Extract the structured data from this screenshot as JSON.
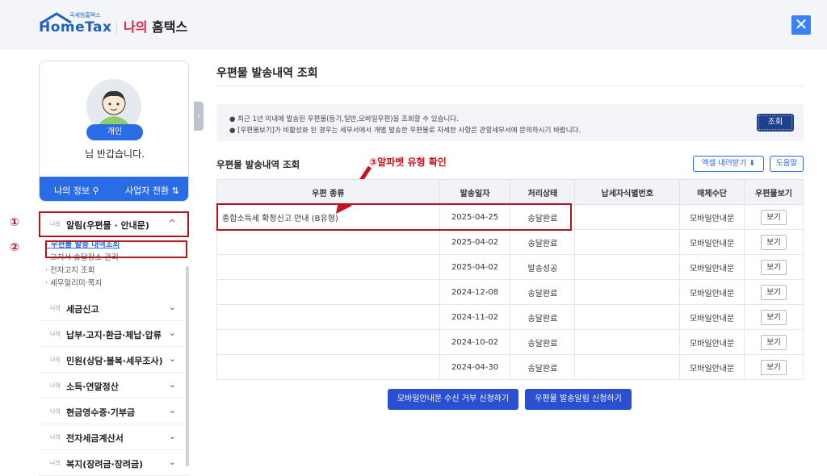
{
  "header": {
    "logo_small": "국세청홈택스",
    "logo_main": "HomeTax",
    "my_prefix": "나의",
    "my_suffix": "홈택스"
  },
  "profile": {
    "badge": "개인",
    "greeting": "님 반갑습니다.",
    "my_info": "나의 정보",
    "switch": "사업자 전환"
  },
  "menu": {
    "prefix": "나의",
    "sections": [
      {
        "label": "알림(우편물 · 안내문)",
        "chev": "^"
      },
      {
        "label": "세금신고",
        "chev": "⌄"
      },
      {
        "label": "납부·고지·환급·체납·압류",
        "chev": "⌄"
      },
      {
        "label": "민원(상담·불복·세무조사)",
        "chev": "⌄"
      },
      {
        "label": "소득·연말정산",
        "chev": "⌄"
      },
      {
        "label": "현금영수증·기부금",
        "chev": "⌄"
      },
      {
        "label": "전자세금계산서",
        "chev": "⌄"
      },
      {
        "label": "복지(장려금·장려금)",
        "chev": "⌄"
      }
    ],
    "sub_items": [
      "우편물 발송 내역조회",
      "고지서 송달장소 관리",
      "전자고지 조회",
      "세무알리미·쪽지"
    ]
  },
  "annotations": {
    "c1": "①",
    "c2": "②",
    "c3": "③알파벳 유형 확인"
  },
  "main": {
    "title": "우편물 발송내역 조회",
    "notice1": "최근 1년 이내에 발송된 우편물(등기,일반,모바일우편)을 조회할 수 있습니다.",
    "notice2": "[우편물보기]가 비활성화 된 경우는 세무서에서 개별 발송한 우편물로 자세한 사항은 관할세무서에 문의하시기 바랍니다.",
    "query_btn": "조회",
    "section_title": "우편물 발송내역 조회",
    "excel_btn": "엑셀 내려받기",
    "help_btn": "도움말",
    "table": {
      "headers": [
        "우편 종류",
        "발송일자",
        "처리상태",
        "납세자식별번호",
        "매체수단",
        "우편물보기"
      ],
      "rows": [
        {
          "type": "종합소득세 확정신고 안내 (B유형)",
          "date": "2025-04-25",
          "status": "송달완료",
          "id": "",
          "media": "모바일안내문",
          "view": "보기"
        },
        {
          "type": "",
          "date": "2025-04-02",
          "status": "송달완료",
          "id": "",
          "media": "모바일안내문",
          "view": "보기"
        },
        {
          "type": "",
          "date": "2025-04-02",
          "status": "발송성공",
          "id": "",
          "media": "모바일안내문",
          "view": "보기"
        },
        {
          "type": "",
          "date": "2024-12-08",
          "status": "송달완료",
          "id": "",
          "media": "모바일안내문",
          "view": "보기"
        },
        {
          "type": "",
          "date": "2024-11-02",
          "status": "송달완료",
          "id": "",
          "media": "모바일안내문",
          "view": "보기"
        },
        {
          "type": "",
          "date": "2024-10-02",
          "status": "송달완료",
          "id": "",
          "media": "모바일안내문",
          "view": "보기"
        },
        {
          "type": "",
          "date": "2024-04-30",
          "status": "송달완료",
          "id": "",
          "media": "모바일안내문",
          "view": "보기"
        }
      ]
    },
    "btn_reject": "모바일안내문 수신 거부 신청하기",
    "btn_notify": "우편물 발송알림 신청하기"
  },
  "colors": {
    "accent": "#2a6be6",
    "highlight": "#b4141c",
    "brand_red": "#e0253c"
  }
}
